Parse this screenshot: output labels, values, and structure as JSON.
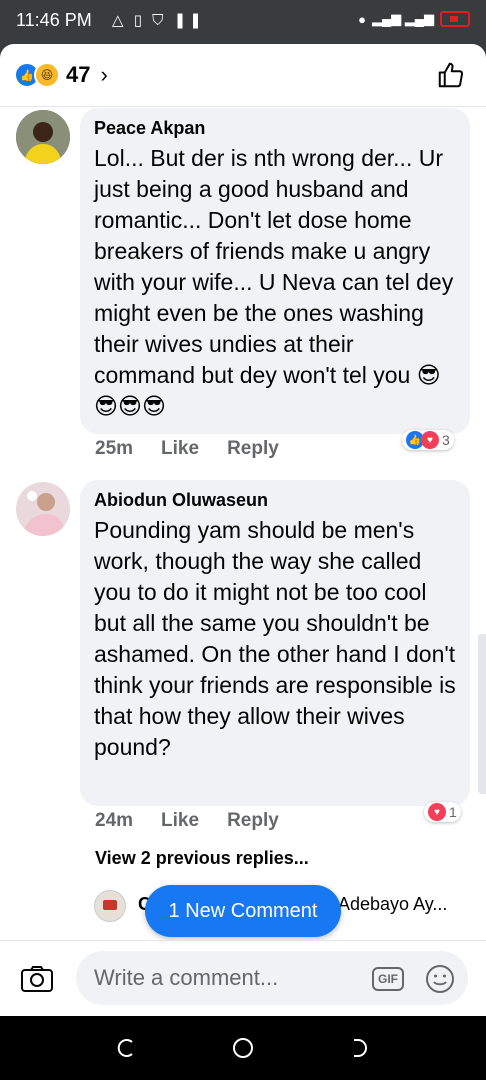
{
  "status_bar": {
    "time": "11:46 PM",
    "left_icons": [
      "warning-icon",
      "sim-icon",
      "shield-icon",
      "pause-icon"
    ],
    "right_icons": [
      "alarm-icon",
      "signal-icon",
      "battery-low-icon"
    ]
  },
  "header": {
    "reaction_icons": [
      "like-reaction-icon",
      "haha-reaction-icon"
    ],
    "reaction_count": "47",
    "chevron": "›"
  },
  "comments": [
    {
      "author": "Peace Akpan",
      "text": "Lol... But der is nth wrong der... Ur just being a good husband and romantic... Don't let dose home breakers of friends  make u angry with your wife... U Neva can tel dey might even be the ones washing their wives undies at their command but dey won't tel you 😎😎😎😎",
      "time": "25m",
      "like_label": "Like",
      "reply_label": "Reply",
      "reactions": [
        "like",
        "love"
      ],
      "reaction_count": "3"
    },
    {
      "author": "Abiodun Oluwaseun",
      "text": "Pounding yam should be men's work, though the way she called you to do it might not be too cool but all the same you shouldn't be ashamed. On the other hand I don't think your friends are responsible is that how they allow their wives pound?",
      "time": "24m",
      "like_label": "Like",
      "reply_label": "Reply",
      "reactions": [
        "love"
      ],
      "reaction_count": "1"
    }
  ],
  "replies": {
    "view_previous": "View 2 previous replies...",
    "reply_initial": "C",
    "reply_name": "Adebayo Ay..."
  },
  "new_comment_button": "1 New Comment",
  "composer": {
    "placeholder": "Write a comment...",
    "gif_label": "GIF"
  },
  "colors": {
    "accent": "#1877f2",
    "bubble": "#f0f2f5",
    "secondary_text": "#65676b",
    "love": "#f33e58",
    "haha": "#f7b928"
  }
}
